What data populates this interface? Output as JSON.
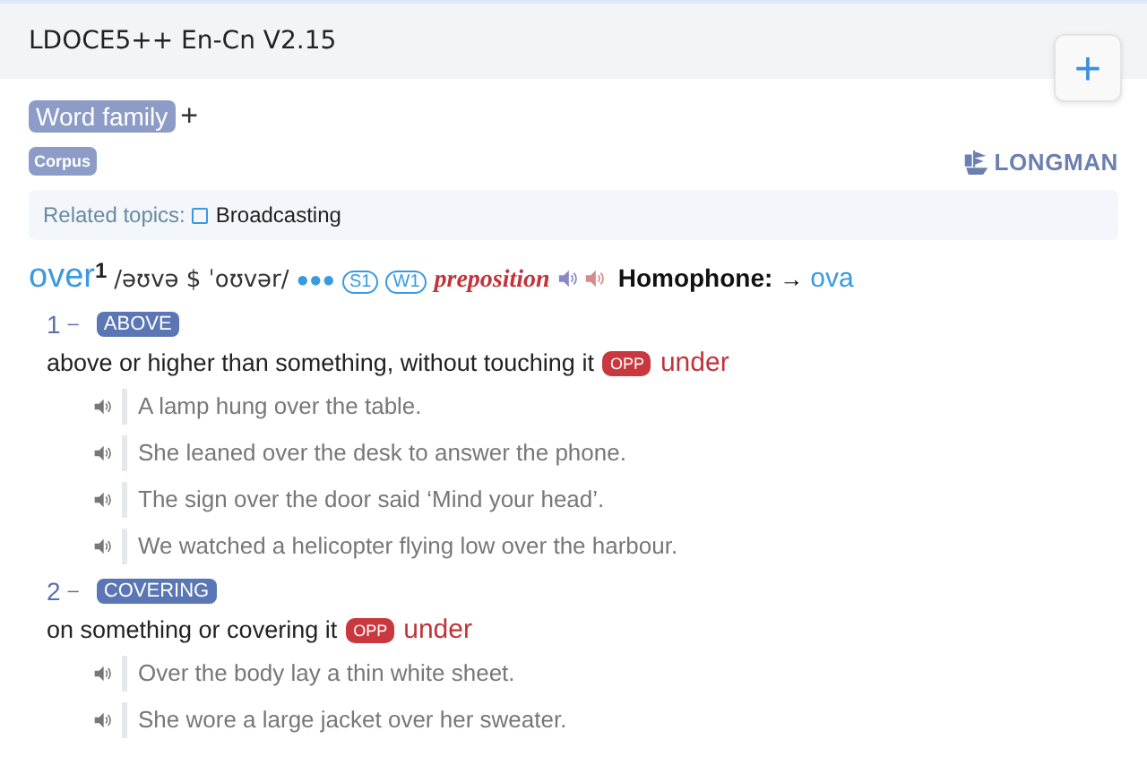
{
  "window": {
    "title": "LDOCE5++ En-Cn V2.15"
  },
  "add_button": "+",
  "word_family": {
    "label": "Word family",
    "toggle": "+"
  },
  "corpus": "Corpus",
  "brand": "LONGMAN",
  "related_topics": {
    "label": "Related topics:",
    "topic": "Broadcasting"
  },
  "headword": {
    "word": "over",
    "homnum": "1",
    "pron": "/əʊvə $ ˈoʊvər/",
    "frequency": "●●●",
    "registers": [
      "S1",
      "W1"
    ],
    "pos": "preposition",
    "homophone_label": "Homophone:",
    "homophone_arrow": "→",
    "homophone": "ova"
  },
  "senses": [
    {
      "number": "1",
      "dash": "–",
      "signpost": "ABOVE",
      "definition": "above or higher than something, without touching it",
      "opp_label": "OPP",
      "opp": "under",
      "examples": [
        "A lamp hung over the table.",
        "She leaned over the desk to answer the phone.",
        "The sign over the door said ‘Mind your head’.",
        "We watched a helicopter flying low over the harbour."
      ]
    },
    {
      "number": "2",
      "dash": "–",
      "signpost": "COVERING",
      "definition": "on something or covering it",
      "opp_label": "OPP",
      "opp": "under",
      "examples": [
        "Over the body lay a thin white sheet.",
        "She wore a large jacket over her sweater."
      ]
    }
  ]
}
